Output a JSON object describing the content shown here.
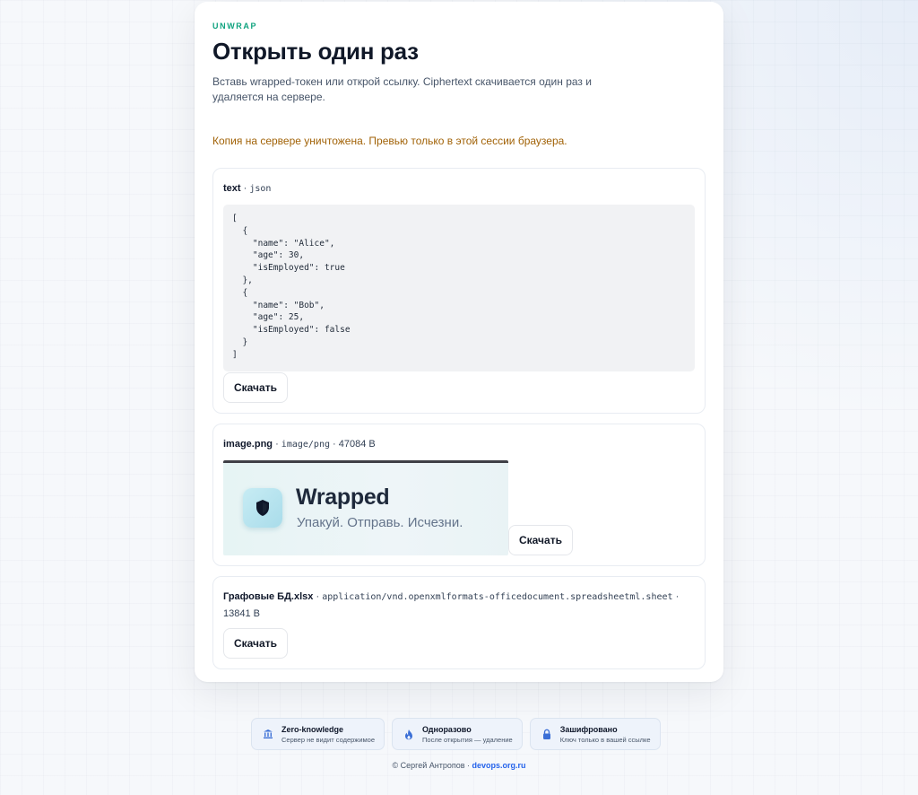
{
  "header": {
    "eyebrow": "UNWRAP",
    "title": "Открыть один раз",
    "subtitle": "Вставь wrapped-токен или открой ссылку. Ciphertext скачивается один раз и удаляется на сервере."
  },
  "notice": "Копия на сервере уничтожена. Превью только в этой сессии браузера.",
  "items": [
    {
      "name": "text",
      "sep1": " · ",
      "type": "json",
      "content": "[\n  {\n    \"name\": \"Alice\",\n    \"age\": 30,\n    \"isEmployed\": true\n  },\n  {\n    \"name\": \"Bob\",\n    \"age\": 25,\n    \"isEmployed\": false\n  }\n]",
      "download_label": "Скачать"
    },
    {
      "name": "image.png",
      "sep1": " · ",
      "type": "image/png",
      "sep2": " · ",
      "size": "47084 B",
      "preview": {
        "title": "Wrapped",
        "subtitle": "Упакуй. Отправь. Исчезни.",
        "icon": "shield-icon"
      },
      "download_label": "Скачать"
    },
    {
      "name": "Графовые БД.xlsx",
      "sep1": " · ",
      "type": "application/vnd.openxmlformats-officedocument.spreadsheetml.sheet",
      "sep2": " · ",
      "size": "13841 B",
      "download_label": "Скачать"
    }
  ],
  "badges": [
    {
      "title": "Zero-knowledge",
      "subtitle": "Сервер не видит содержимое",
      "icon": "bank-icon"
    },
    {
      "title": "Одноразово",
      "subtitle": "После открытия — удаление",
      "icon": "flame-icon"
    },
    {
      "title": "Зашифровано",
      "subtitle": "Ключ только в вашей ссылке",
      "icon": "lock-icon"
    }
  ],
  "footer": {
    "copyright": "© Сергей Антропов · ",
    "link_text": "devops.org.ru"
  },
  "colors": {
    "accent": "#10a37f",
    "notice": "#a16207",
    "link": "#2563eb",
    "badge_icon": "#3b6fd6"
  }
}
